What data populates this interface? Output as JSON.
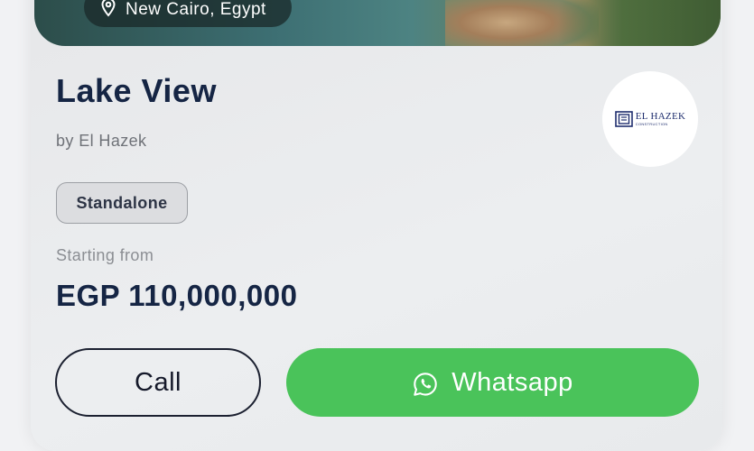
{
  "listing": {
    "location": "New Cairo, Egypt",
    "title": "Lake View",
    "developer": "by El Hazek",
    "tag": "Standalone",
    "price_label": "Starting from",
    "price": "EGP 110,000,000"
  },
  "developer_logo": {
    "name": "EL HAZEK",
    "subtitle": "CONSTRUCTION"
  },
  "actions": {
    "call_label": "Call",
    "whatsapp_label": "Whatsapp"
  },
  "colors": {
    "title": "#152544",
    "whatsapp": "#4ac35a",
    "call_border": "#1b2030"
  },
  "icons": [
    "location-pin-icon",
    "whatsapp-icon"
  ]
}
